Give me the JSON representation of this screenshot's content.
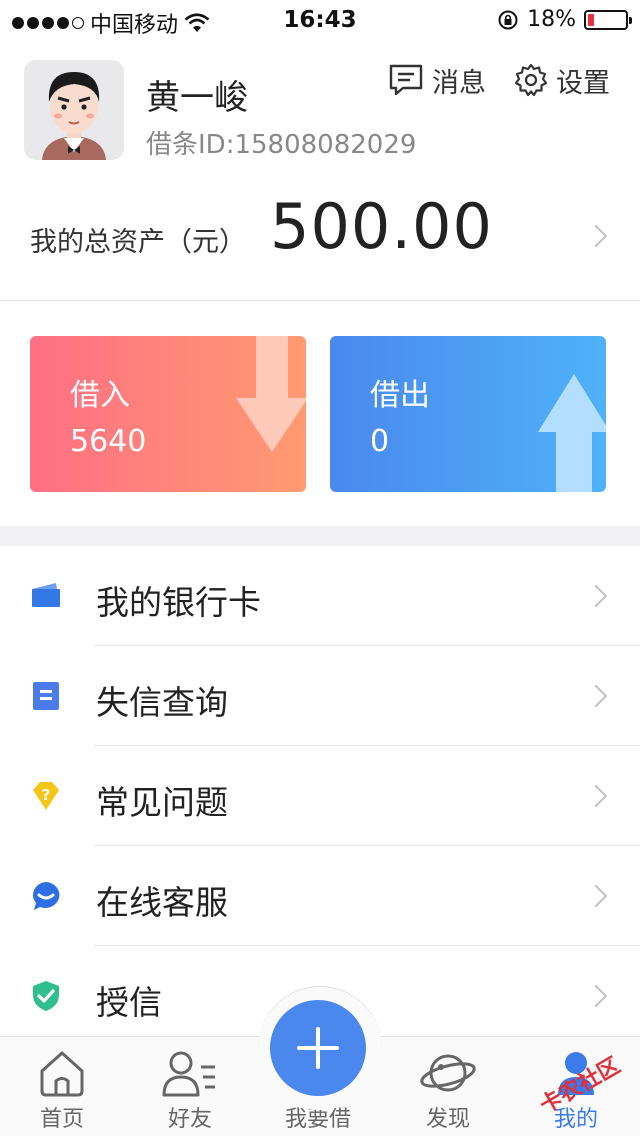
{
  "status_bar": {
    "carrier": "中国移动",
    "time": "16:43",
    "battery_text": "18%",
    "battery_level": 0.18,
    "signal_dots": 5,
    "signal_filled": 4
  },
  "profile": {
    "name": "黄一峻",
    "id_text": "借条ID:15808082029"
  },
  "header_actions": {
    "messages_label": "消息",
    "settings_label": "设置"
  },
  "assets": {
    "label": "我的总资产（元）",
    "value": "500.00"
  },
  "cards": {
    "borrow": {
      "title": "借入",
      "value": "5640"
    },
    "lend": {
      "title": "借出",
      "value": "0"
    }
  },
  "menu": [
    {
      "label": "我的银行卡",
      "icon": "bank-card-icon",
      "color": "#3478e5"
    },
    {
      "label": "失信查询",
      "icon": "document-icon",
      "color": "#4a7be8"
    },
    {
      "label": "常见问题",
      "icon": "faq-icon",
      "color": "#f5c518"
    },
    {
      "label": "在线客服",
      "icon": "chat-bubble-icon",
      "color": "#2f6fe4"
    },
    {
      "label": "授信",
      "icon": "shield-check-icon",
      "color": "#2fbf8f"
    }
  ],
  "tabs": [
    {
      "label": "首页",
      "icon": "home-icon"
    },
    {
      "label": "好友",
      "icon": "friends-icon"
    },
    {
      "label": "我要借",
      "icon": "plus-icon"
    },
    {
      "label": "发现",
      "icon": "planet-icon"
    },
    {
      "label": "我的",
      "icon": "user-icon"
    }
  ],
  "watermark": "卡农社区",
  "colors": {
    "accent": "#4a88ee",
    "borrow_gradient": [
      "#ff6f84",
      "#ff9a72"
    ],
    "lend_gradient": [
      "#4a88ee",
      "#4fb2f8"
    ]
  }
}
